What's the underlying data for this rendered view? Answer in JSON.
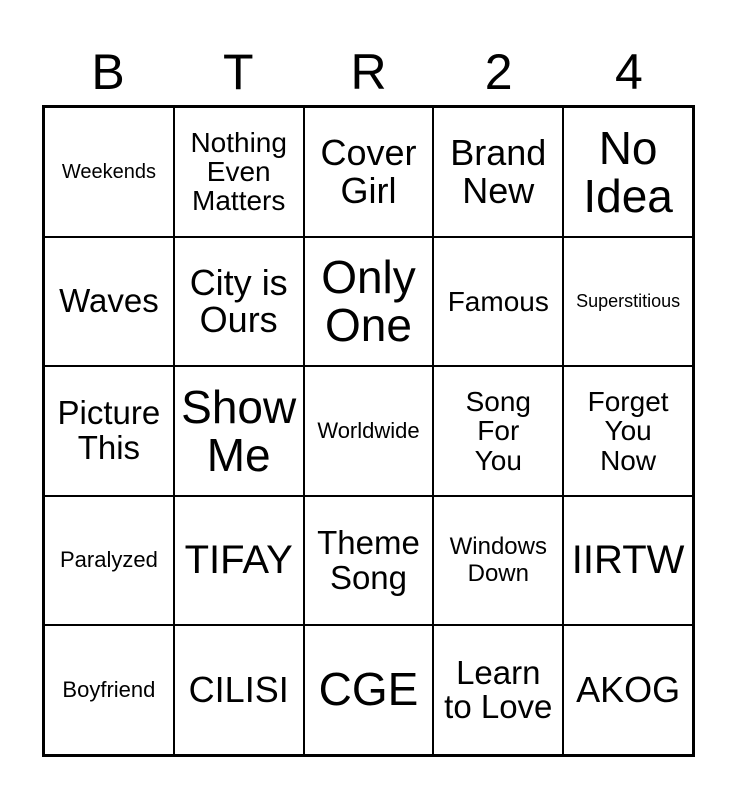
{
  "header": {
    "letters": [
      "B",
      "T",
      "R",
      "2",
      "4"
    ]
  },
  "board": {
    "rows": [
      [
        "Weekends",
        "Nothing\nEven\nMatters",
        "Cover\nGirl",
        "Brand\nNew",
        "No\nIdea"
      ],
      [
        "Waves",
        "City is\nOurs",
        "Only\nOne",
        "Famous",
        "Superstitious"
      ],
      [
        "Picture\nThis",
        "Show\nMe",
        "Worldwide",
        "Song\nFor\nYou",
        "Forget\nYou\nNow"
      ],
      [
        "Paralyzed",
        "TIFAY",
        "Theme\nSong",
        "Windows\nDown",
        "IIRTW"
      ],
      [
        "Boyfriend",
        "CILISI",
        "CGE",
        "Learn\nto Love",
        "AKOG"
      ]
    ]
  }
}
